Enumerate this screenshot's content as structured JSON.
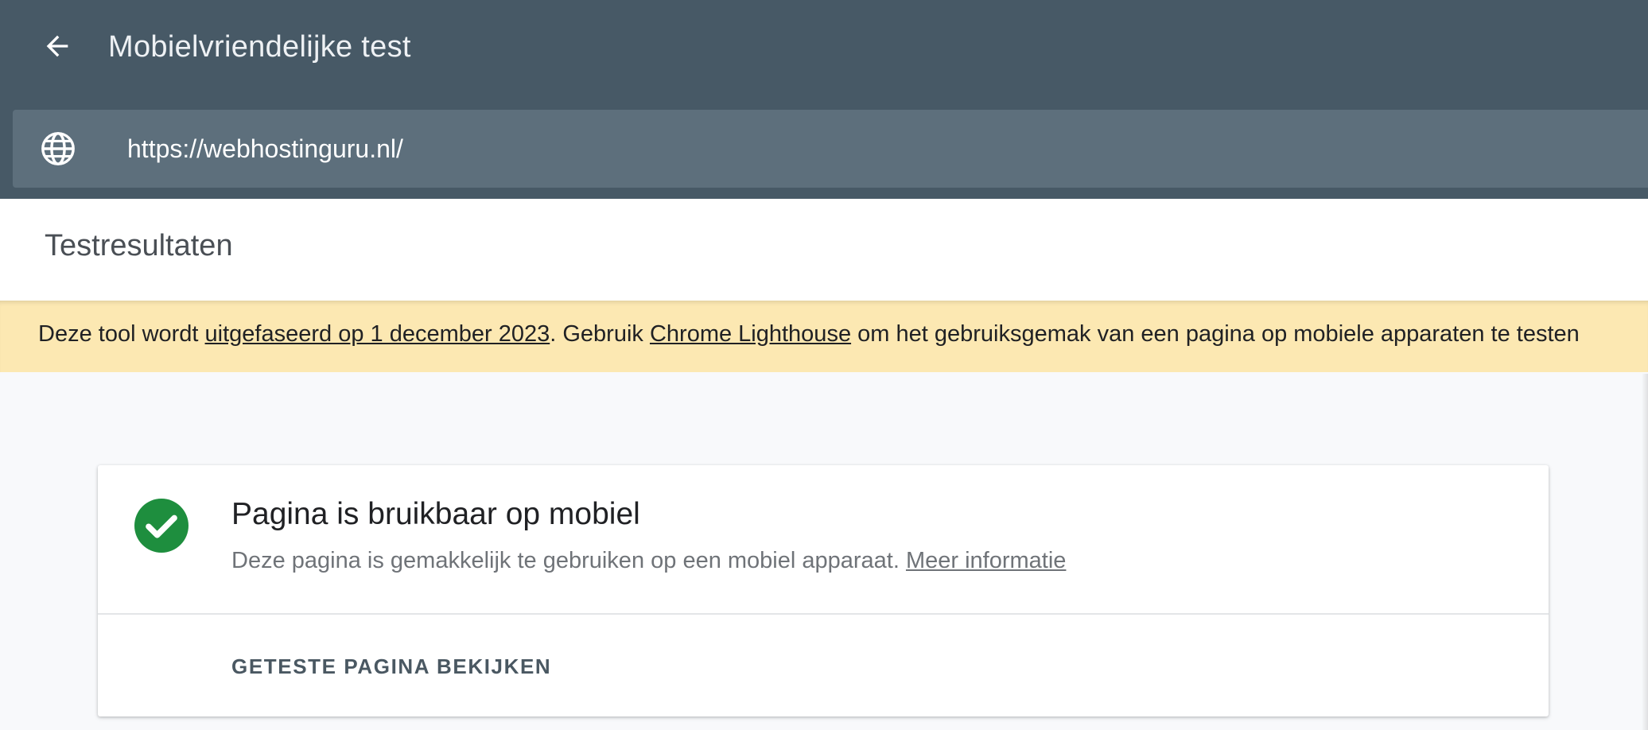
{
  "header": {
    "back_icon": "arrow-left-icon",
    "title": "Mobielvriendelijke test"
  },
  "url_bar": {
    "icon": "globe-icon",
    "value": "https://webhostinguru.nl/"
  },
  "results": {
    "title": "Testresultaten"
  },
  "banner": {
    "text_before": "Deze tool wordt ",
    "link1": "uitgefaseerd op 1 december 2023",
    "text_middle": ". Gebruik ",
    "link2": "Chrome Lighthouse",
    "text_after": " om het gebruiksgemak van een pagina op mobiele apparaten te testen",
    "background": "#fce8b2"
  },
  "result_card": {
    "status_icon": "check-circle-icon",
    "status_color": "#1e8e3e",
    "title": "Pagina is bruikbaar op mobiel",
    "description": "Deze pagina is gemakkelijk te gebruiken op een mobiel apparaat. ",
    "more_info_link": "Meer informatie",
    "action_label": "GETESTE PAGINA BEKIJKEN"
  },
  "colors": {
    "topbar": "#475966",
    "url_bar": "#5d6f7c"
  }
}
